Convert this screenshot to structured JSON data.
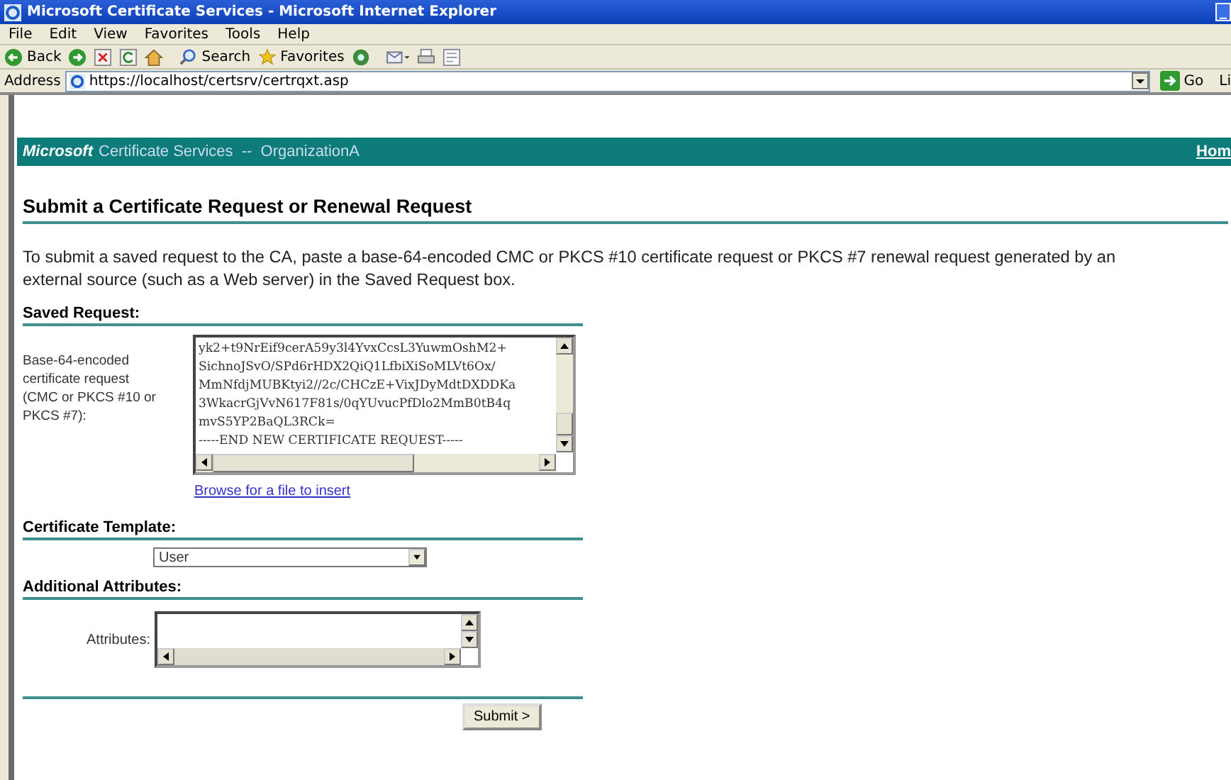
{
  "window": {
    "title": "Microsoft Certificate Services - Microsoft Internet Explorer",
    "minimize": "_"
  },
  "menu": [
    "File",
    "Edit",
    "View",
    "Favorites",
    "Tools",
    "Help"
  ],
  "toolbar": [
    {
      "kind": "back",
      "label": "Back"
    },
    {
      "kind": "forward"
    },
    {
      "kind": "stop"
    },
    {
      "kind": "refresh"
    },
    {
      "kind": "home"
    },
    {
      "kind": "search",
      "label": "Search"
    },
    {
      "kind": "favorites",
      "label": "Favorites"
    },
    {
      "kind": "media"
    },
    {
      "kind": "mail"
    },
    {
      "kind": "print"
    },
    {
      "kind": "edit"
    }
  ],
  "address": {
    "label": "Address",
    "url": "https://localhost/certsrv/certrqxt.asp",
    "go": "Go",
    "links": "Li"
  },
  "banner": {
    "brand": "Microsoft",
    "title": "Certificate Services  --  OrganizationA",
    "home_link": "Hom"
  },
  "heading": "Submit a Certificate Request or Renewal Request",
  "intro": "To submit a saved request to the CA, paste a base-64-encoded CMC or PKCS #10 certificate request or PKCS #7 renewal request generated by an external source (such as a Web server) in the Saved Request box.",
  "saved_request": {
    "heading": "Saved Request:",
    "label": "Base-64-encoded certificate request (CMC or PKCS #10 or PKCS #7):",
    "lines": [
      "yk2+t9NrEif9cerA59y3l4YvxCcsL3YuwmOshM2+",
      "SichnoJSvO/SPd6rHDX2QiQ1LfbiXiSoMLVt6Ox/",
      "MmNfdjMUBKtyi2//2c/CHCzE+VixJDyMdtDXDDKa",
      "3WkacrGjVvN617F81s/0qYUvucPfDlo2MmB0tB4q",
      "mvS5YP2BaQL3RCk=",
      "-----END NEW CERTIFICATE REQUEST-----"
    ],
    "browse_link": "Browse for a file to insert"
  },
  "template": {
    "heading": "Certificate Template:",
    "value": "User"
  },
  "attributes": {
    "heading": "Additional Attributes:",
    "label": "Attributes:"
  },
  "submit": "Submit >"
}
